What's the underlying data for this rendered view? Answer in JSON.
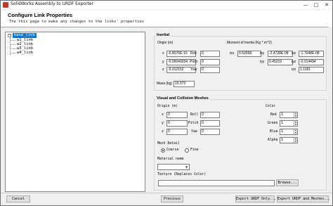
{
  "window": {
    "title": "SolidWorks Assembly to URDF Exporter",
    "minimize": "—",
    "maximize": "□",
    "close": "✕"
  },
  "header": {
    "title": "Configure Link Properties",
    "subtitle": "The this page to make any changes to the links' properties"
  },
  "tree": {
    "root": "base_link",
    "children": [
      "w1_link",
      "w2_link",
      "w3_link",
      "w4_link"
    ],
    "expander": "−"
  },
  "inertial": {
    "title": "Inertial",
    "origin_label": "Origin (m)",
    "moi_label": "Moment of Inertia (Kg * m^2)",
    "x_label": "x",
    "y_label": "y",
    "z_label": "z",
    "x": "-6.8076E-10",
    "y": "-0.00040034",
    "z": "-0.012152",
    "roll_label": "Roll",
    "pitch_label": "Pitch",
    "yaw_label": "Yaw",
    "roll": "0",
    "pitch": "0",
    "yaw": "0",
    "ixx_label": "ixx",
    "ixy_label": "ixy",
    "ixz_label": "ixz",
    "iyy_label": "iyy",
    "iyz_label": "iyz",
    "izz_label": "izz",
    "ixx": "0.52658",
    "ixy": "-2.4728E-08",
    "ixz": "-1.7048E-08",
    "iyy": "0.45219",
    "iyz": "-0.014494",
    "izz": "1.1181",
    "mass_label": "Mass (kg)",
    "mass": "15.573"
  },
  "visual": {
    "title": "Visual and Collision Meshes",
    "origin_label": "Origin (m)",
    "x_label": "x",
    "y_label": "y",
    "z_label": "z",
    "x": "0",
    "y": "0",
    "z": "0",
    "roll_label": "Roll",
    "pitch_label": "Pitch",
    "yaw_label": "Yaw",
    "roll": "0",
    "pitch": "0",
    "yaw": "0",
    "color_label": "Color",
    "red_label": "Red",
    "green_label": "Green",
    "blue_label": "Blue",
    "alpha_label": "Alpha",
    "red": "1",
    "green": "1",
    "blue": "1",
    "alpha": "1",
    "mesh_detail_label": "Mesh Detail",
    "coarse_label": "Coarse",
    "fine_label": "Fine",
    "material_label": "Material name",
    "material_value": "",
    "texture_label": "Texture (Replaces Color)",
    "texture_value": "",
    "browse_label": "Browse..."
  },
  "footer": {
    "cancel": "Cancel",
    "previous": "Previous",
    "export_urdf_only": "Export URDF Only...",
    "export_urdf_meshes": "Export URDF and Meshes..."
  },
  "colors": {
    "selection": "#0078d7",
    "window_bg": "#f0f0f0"
  }
}
